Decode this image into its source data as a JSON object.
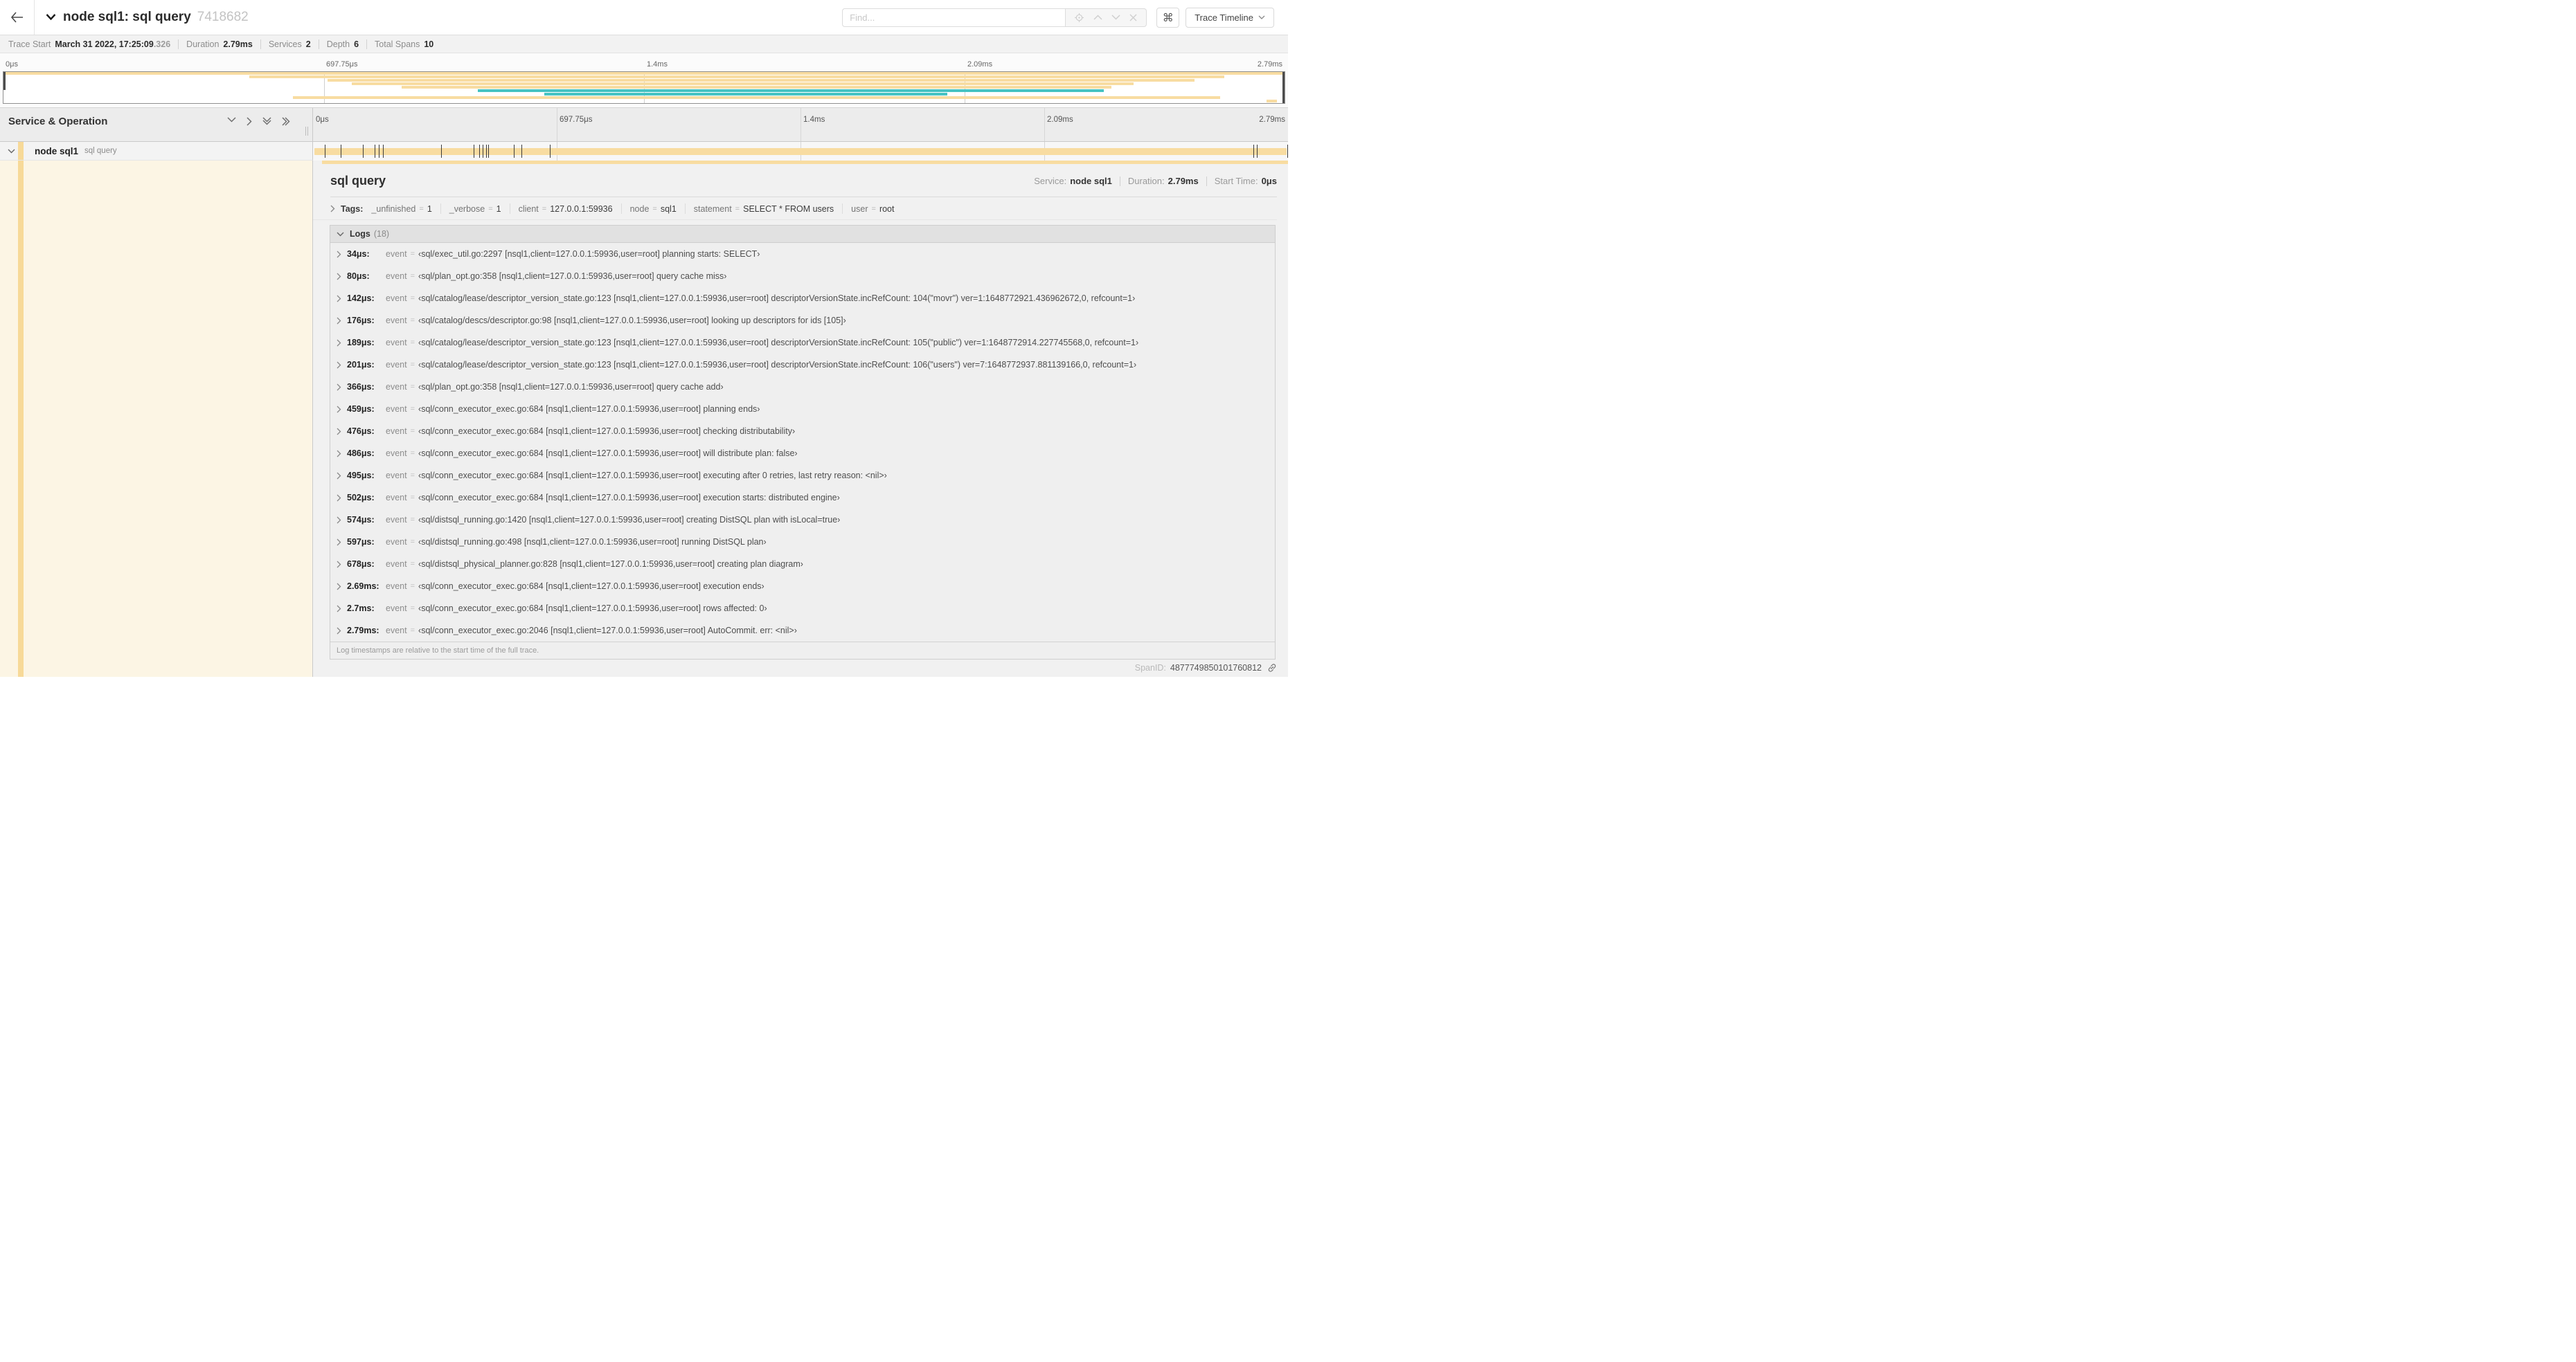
{
  "header": {
    "title": "node sql1: sql query",
    "trace_id": "7418682",
    "find_placeholder": "Find...",
    "shortcut_icon": "⌘",
    "view_button": "Trace Timeline"
  },
  "trace_meta": [
    {
      "label": "Trace Start",
      "value": "March 31 2022, 17:25:09",
      "suffix": ".326"
    },
    {
      "label": "Duration",
      "value": "2.79ms"
    },
    {
      "label": "Services",
      "value": "2"
    },
    {
      "label": "Depth",
      "value": "6"
    },
    {
      "label": "Total Spans",
      "value": "10"
    }
  ],
  "axis": {
    "ticks": [
      {
        "label": "0μs",
        "pct": 0
      },
      {
        "label": "697.75μs",
        "pct": 25
      },
      {
        "label": "1.4ms",
        "pct": 50
      },
      {
        "label": "2.09ms",
        "pct": 75
      },
      {
        "label": "2.79ms",
        "pct": 100
      }
    ]
  },
  "colors": {
    "tan": "#f8dca1",
    "teal": "#46c3c3",
    "cream": "#fcf5e4",
    "strip": "#f7d998"
  },
  "minimap_spans": [
    {
      "start": 0,
      "end": 100,
      "color": "tan"
    },
    {
      "start": 19.2,
      "end": 95.3,
      "color": "tan"
    },
    {
      "start": 25.3,
      "end": 93.0,
      "color": "tan"
    },
    {
      "start": 27.2,
      "end": 88.2,
      "color": "tan"
    },
    {
      "start": 31.1,
      "end": 86.5,
      "color": "tan"
    },
    {
      "start": 37.0,
      "end": 85.9,
      "color": "teal"
    },
    {
      "start": 42.2,
      "end": 73.7,
      "color": "teal"
    },
    {
      "start": 22.6,
      "end": 95.0,
      "color": "tan"
    },
    {
      "start": 98.6,
      "end": 99.4,
      "color": "tan"
    }
  ],
  "timeline": {
    "column_header": "Service & Operation"
  },
  "span_row": {
    "service": "node sql1",
    "operation": "sql query"
  },
  "detail": {
    "title": "sql query",
    "meta": [
      {
        "label": "Service:",
        "value": "node sql1"
      },
      {
        "label": "Duration:",
        "value": "2.79ms"
      },
      {
        "label": "Start Time:",
        "value": "0μs"
      }
    ],
    "tags_label": "Tags:",
    "tags": [
      {
        "key": "_unfinished",
        "value": "1"
      },
      {
        "key": "_verbose",
        "value": "1"
      },
      {
        "key": "client",
        "value": "127.0.0.1:59936"
      },
      {
        "key": "node",
        "value": "sql1"
      },
      {
        "key": "statement",
        "value": "SELECT * FROM users"
      },
      {
        "key": "user",
        "value": "root"
      }
    ],
    "logs_title": "Logs",
    "logs_count": "(18)",
    "logs": [
      {
        "time": "34μs:",
        "field": "event",
        "pct": 1.22,
        "value": "‹sql/exec_util.go:2297 [nsql1,client=127.0.0.1:59936,user=root] planning starts: SELECT›"
      },
      {
        "time": "80μs:",
        "field": "event",
        "pct": 2.87,
        "value": "‹sql/plan_opt.go:358 [nsql1,client=127.0.0.1:59936,user=root] query cache miss›"
      },
      {
        "time": "142μs:",
        "field": "event",
        "pct": 5.09,
        "value": "‹sql/catalog/lease/descriptor_version_state.go:123 [nsql1,client=127.0.0.1:59936,user=root] descriptorVersionState.incRefCount: 104(\"movr\") ver=1:1648772921.436962672,0, refcount=1›"
      },
      {
        "time": "176μs:",
        "field": "event",
        "pct": 6.31,
        "value": "‹sql/catalog/descs/descriptor.go:98 [nsql1,client=127.0.0.1:59936,user=root] looking up descriptors for ids [105]›"
      },
      {
        "time": "189μs:",
        "field": "event",
        "pct": 6.77,
        "value": "‹sql/catalog/lease/descriptor_version_state.go:123 [nsql1,client=127.0.0.1:59936,user=root] descriptorVersionState.incRefCount: 105(\"public\") ver=1:1648772914.227745568,0, refcount=1›"
      },
      {
        "time": "201μs:",
        "field": "event",
        "pct": 7.2,
        "value": "‹sql/catalog/lease/descriptor_version_state.go:123 [nsql1,client=127.0.0.1:59936,user=root] descriptorVersionState.incRefCount: 106(\"users\") ver=7:1648772937.881139166,0, refcount=1›"
      },
      {
        "time": "366μs:",
        "field": "event",
        "pct": 13.12,
        "value": "‹sql/plan_opt.go:358 [nsql1,client=127.0.0.1:59936,user=root] query cache add›"
      },
      {
        "time": "459μs:",
        "field": "event",
        "pct": 16.45,
        "value": "‹sql/conn_executor_exec.go:684 [nsql1,client=127.0.0.1:59936,user=root] planning ends›"
      },
      {
        "time": "476μs:",
        "field": "event",
        "pct": 17.06,
        "value": "‹sql/conn_executor_exec.go:684 [nsql1,client=127.0.0.1:59936,user=root] checking distributability›"
      },
      {
        "time": "486μs:",
        "field": "event",
        "pct": 17.42,
        "value": "‹sql/conn_executor_exec.go:684 [nsql1,client=127.0.0.1:59936,user=root] will distribute plan: false›"
      },
      {
        "time": "495μs:",
        "field": "event",
        "pct": 17.74,
        "value": "‹sql/conn_executor_exec.go:684 [nsql1,client=127.0.0.1:59936,user=root] executing after 0 retries, last retry reason: <nil>›"
      },
      {
        "time": "502μs:",
        "field": "event",
        "pct": 18.0,
        "value": "‹sql/conn_executor_exec.go:684 [nsql1,client=127.0.0.1:59936,user=root] execution starts: distributed engine›"
      },
      {
        "time": "574μs:",
        "field": "event",
        "pct": 20.57,
        "value": "‹sql/distsql_running.go:1420 [nsql1,client=127.0.0.1:59936,user=root] creating DistSQL plan with isLocal=true›"
      },
      {
        "time": "597μs:",
        "field": "event",
        "pct": 21.4,
        "value": "‹sql/distsql_running.go:498 [nsql1,client=127.0.0.1:59936,user=root] running DistSQL plan›"
      },
      {
        "time": "678μs:",
        "field": "event",
        "pct": 24.3,
        "value": "‹sql/distsql_physical_planner.go:828 [nsql1,client=127.0.0.1:59936,user=root] creating plan diagram›"
      },
      {
        "time": "2.69ms:",
        "field": "event",
        "pct": 96.42,
        "value": "‹sql/conn_executor_exec.go:684 [nsql1,client=127.0.0.1:59936,user=root] execution ends›"
      },
      {
        "time": "2.7ms:",
        "field": "event",
        "pct": 96.77,
        "value": "‹sql/conn_executor_exec.go:684 [nsql1,client=127.0.0.1:59936,user=root] rows affected: 0›"
      },
      {
        "time": "2.79ms:",
        "field": "event",
        "pct": 99.95,
        "value": "‹sql/conn_executor_exec.go:2046 [nsql1,client=127.0.0.1:59936,user=root] AutoCommit. err: <nil>›"
      }
    ],
    "footer_note": "Log timestamps are relative to the start time of the full trace.",
    "span_id_label": "SpanID:",
    "span_id": "4877749850101760812"
  }
}
